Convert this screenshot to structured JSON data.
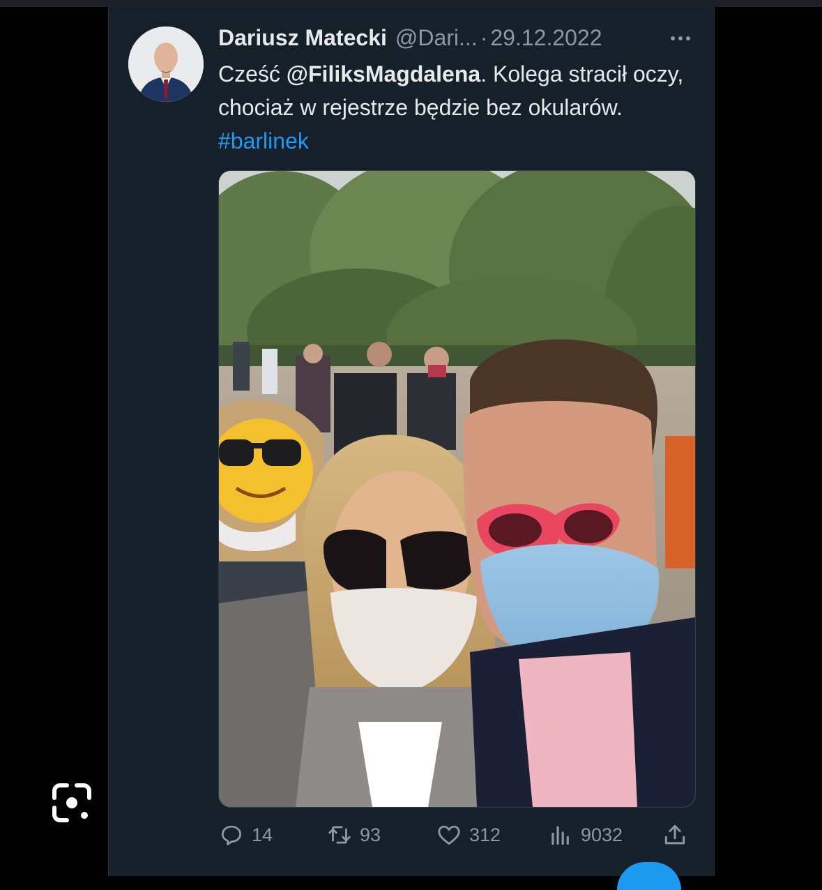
{
  "tweet": {
    "author_name": "Dariusz Matecki",
    "author_handle": "@Dari...",
    "separator": "·",
    "date": "29.12.2022",
    "text_prefix": "Cześć ",
    "mention": "@FiliksMagdalena",
    "text_middle": ". Kolega stracił oczy, chociaż w rejestrze będzie bez okularów. ",
    "hashtag": "#barlinek"
  },
  "actions": {
    "replies": "14",
    "retweets": "93",
    "likes": "312",
    "views": "9032"
  },
  "icons": {
    "more": "more-horizontal-icon",
    "reply": "reply-icon",
    "retweet": "retweet-icon",
    "like": "heart-icon",
    "views": "views-icon",
    "share": "share-icon",
    "lens": "google-lens-icon"
  },
  "colors": {
    "background": "#15202b",
    "text": "#e7e9ea",
    "muted": "#8b98a5",
    "accent": "#1d9bf0"
  }
}
